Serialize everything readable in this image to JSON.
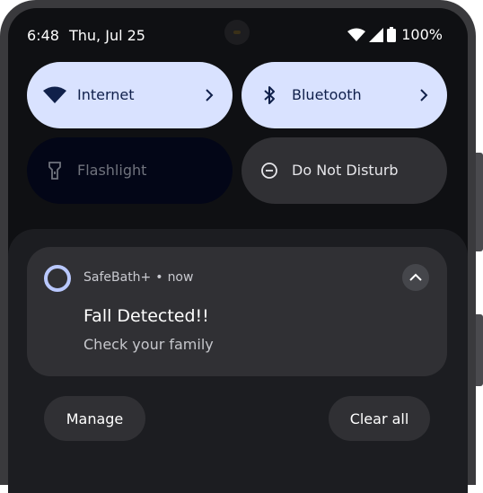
{
  "status_bar": {
    "time": "6:48",
    "date": "Thu, Jul 25",
    "battery": "100%",
    "icons": [
      "wifi-icon",
      "cellular-signal-icon",
      "battery-icon"
    ]
  },
  "quick_settings": {
    "tiles": [
      {
        "label": "Internet",
        "icon": "wifi-icon",
        "state": "on",
        "has_chevron": true
      },
      {
        "label": "Bluetooth",
        "icon": "bluetooth-icon",
        "state": "on",
        "has_chevron": true
      },
      {
        "label": "Flashlight",
        "icon": "flashlight-icon",
        "state": "unavailable"
      },
      {
        "label": "Do Not Disturb",
        "icon": "do-not-disturb-icon",
        "state": "off"
      }
    ]
  },
  "notification": {
    "app_name": "SafeBath+",
    "separator": "•",
    "time": "now",
    "title": "Fall Detected!!",
    "text": "Check your family"
  },
  "actions": {
    "manage": "Manage",
    "clear_all": "Clear all"
  },
  "colors": {
    "tile_active": "#d9e2ff",
    "tile_inactive": "#303034",
    "tile_unavailable": "#030617",
    "shade_background": "#1c1d21",
    "card_background": "#303034",
    "app_icon_ring": "#b9c8ff"
  }
}
